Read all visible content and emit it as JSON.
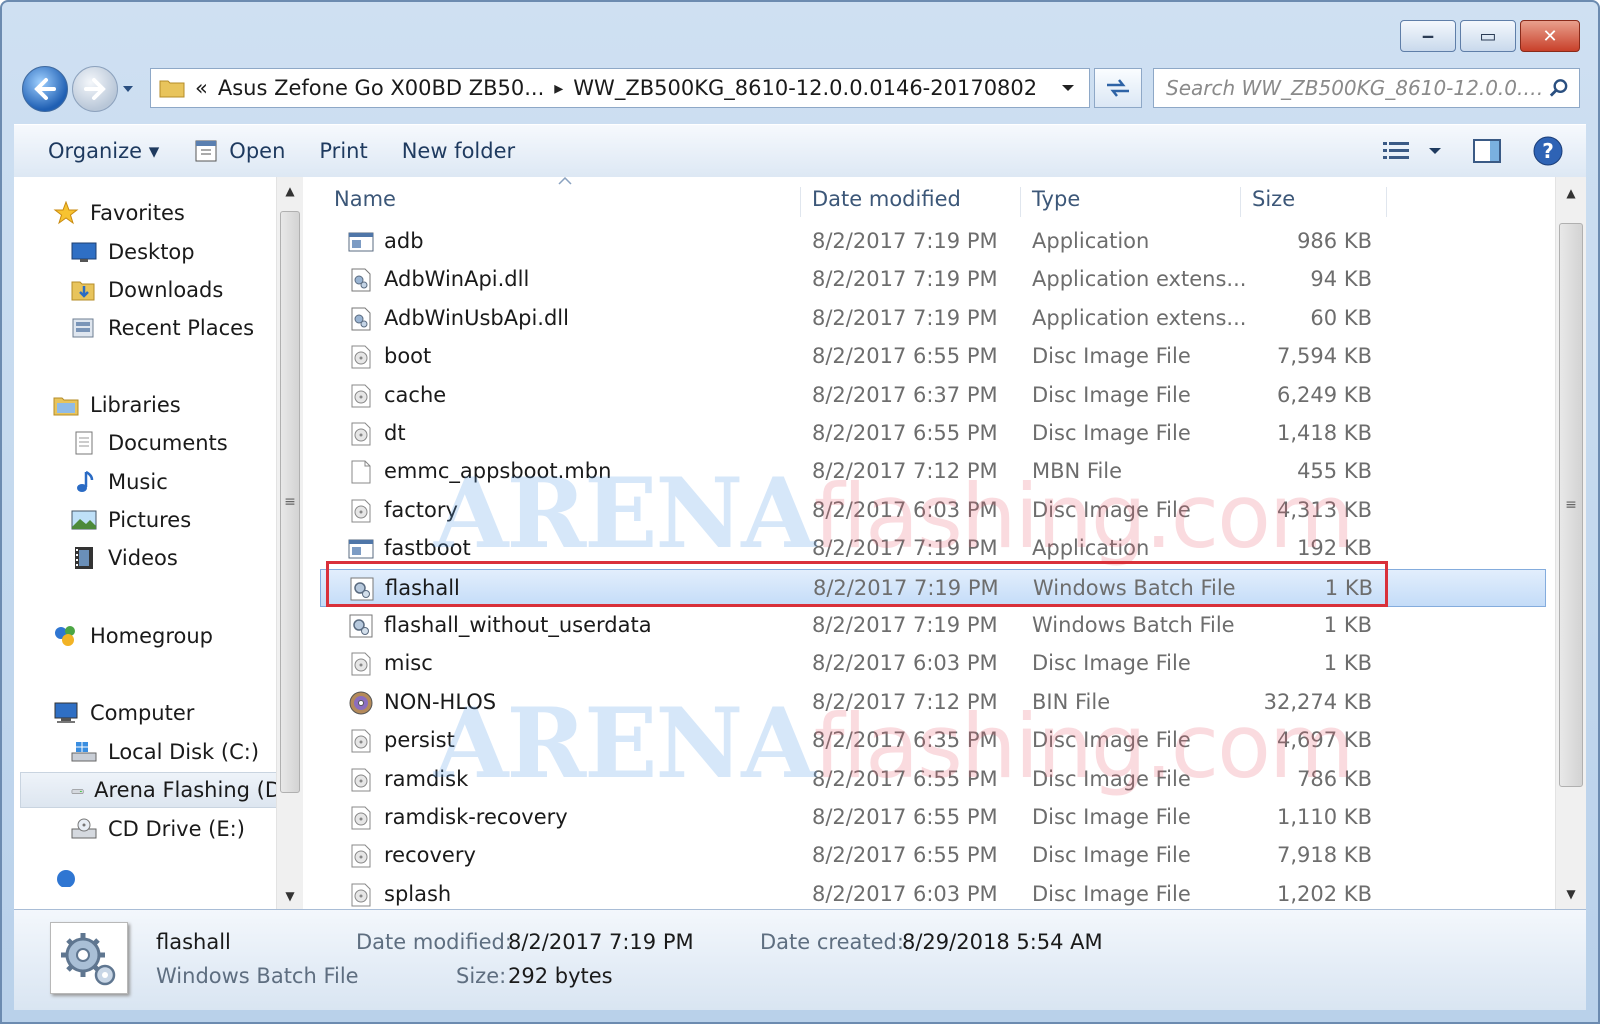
{
  "window": {
    "caption_buttons": {
      "minimize": "‒",
      "maximize": "▭",
      "close": "✕"
    }
  },
  "address": {
    "overflow": "«",
    "segments": [
      "Asus Zefone Go X00BD ZB50...",
      "WW_ZB500KG_8610-12.0.0.0146-20170802"
    ],
    "separator": "▸"
  },
  "search": {
    "placeholder": "Search WW_ZB500KG_8610-12.0.0.014..."
  },
  "toolbar": {
    "organize": "Organize ▾",
    "open": "Open",
    "print": "Print",
    "new_folder": "New folder"
  },
  "nav": {
    "favorites": "Favorites",
    "desktop": "Desktop",
    "downloads": "Downloads",
    "recent": "Recent Places",
    "libraries": "Libraries",
    "documents": "Documents",
    "music": "Music",
    "pictures": "Pictures",
    "videos": "Videos",
    "homegroup": "Homegroup",
    "computer": "Computer",
    "local_disk": "Local Disk (C:)",
    "arena": "Arena Flashing (D",
    "cd": "CD Drive (E:)"
  },
  "columns": {
    "name": "Name",
    "date": "Date modified",
    "type": "Type",
    "size": "Size"
  },
  "files": [
    {
      "name": "adb",
      "date": "8/2/2017 7:19 PM",
      "type": "Application",
      "size": "986 KB",
      "icon": "app-icon"
    },
    {
      "name": "AdbWinApi.dll",
      "date": "8/2/2017 7:19 PM",
      "type": "Application extens...",
      "size": "94 KB",
      "icon": "dll-icon"
    },
    {
      "name": "AdbWinUsbApi.dll",
      "date": "8/2/2017 7:19 PM",
      "type": "Application extens...",
      "size": "60 KB",
      "icon": "dll-icon"
    },
    {
      "name": "boot",
      "date": "8/2/2017 6:55 PM",
      "type": "Disc Image File",
      "size": "7,594 KB",
      "icon": "disc-image-icon"
    },
    {
      "name": "cache",
      "date": "8/2/2017 6:37 PM",
      "type": "Disc Image File",
      "size": "6,249 KB",
      "icon": "disc-image-icon"
    },
    {
      "name": "dt",
      "date": "8/2/2017 6:55 PM",
      "type": "Disc Image File",
      "size": "1,418 KB",
      "icon": "disc-image-icon"
    },
    {
      "name": "emmc_appsboot.mbn",
      "date": "8/2/2017 7:12 PM",
      "type": "MBN File",
      "size": "455 KB",
      "icon": "blank-file-icon"
    },
    {
      "name": "factory",
      "date": "8/2/2017 6:03 PM",
      "type": "Disc Image File",
      "size": "4,313 KB",
      "icon": "disc-image-icon"
    },
    {
      "name": "fastboot",
      "date": "8/2/2017 7:19 PM",
      "type": "Application",
      "size": "192 KB",
      "icon": "app-icon"
    },
    {
      "name": "flashall",
      "date": "8/2/2017 7:19 PM",
      "type": "Windows Batch File",
      "size": "1 KB",
      "icon": "batch-file-icon"
    },
    {
      "name": "flashall_without_userdata",
      "date": "8/2/2017 7:19 PM",
      "type": "Windows Batch File",
      "size": "1 KB",
      "icon": "batch-file-icon"
    },
    {
      "name": "misc",
      "date": "8/2/2017 6:03 PM",
      "type": "Disc Image File",
      "size": "1 KB",
      "icon": "disc-image-icon"
    },
    {
      "name": "NON-HLOS",
      "date": "8/2/2017 7:12 PM",
      "type": "BIN File",
      "size": "32,274 KB",
      "icon": "bin-disc-icon"
    },
    {
      "name": "persist",
      "date": "8/2/2017 6:35 PM",
      "type": "Disc Image File",
      "size": "4,697 KB",
      "icon": "disc-image-icon"
    },
    {
      "name": "ramdisk",
      "date": "8/2/2017 6:55 PM",
      "type": "Disc Image File",
      "size": "786 KB",
      "icon": "disc-image-icon"
    },
    {
      "name": "ramdisk-recovery",
      "date": "8/2/2017 6:55 PM",
      "type": "Disc Image File",
      "size": "1,110 KB",
      "icon": "disc-image-icon"
    },
    {
      "name": "recovery",
      "date": "8/2/2017 6:55 PM",
      "type": "Disc Image File",
      "size": "7,918 KB",
      "icon": "disc-image-icon"
    },
    {
      "name": "splash",
      "date": "8/2/2017 6:03 PM",
      "type": "Disc Image File",
      "size": "1,202 KB",
      "icon": "disc-image-icon"
    }
  ],
  "selected_index": 9,
  "details": {
    "name": "flashall",
    "type": "Windows Batch File",
    "date_modified_label": "Date modified:",
    "date_modified": "8/2/2017 7:19 PM",
    "date_created_label": "Date created:",
    "date_created": "8/29/2018 5:54 AM",
    "size_label": "Size:",
    "size": "292 bytes"
  },
  "watermark": {
    "brand": "ARENA",
    "domain": "flashing.com"
  },
  "colors": {
    "highlight_box": "#d9303a",
    "selection": "#c4dcf8"
  }
}
